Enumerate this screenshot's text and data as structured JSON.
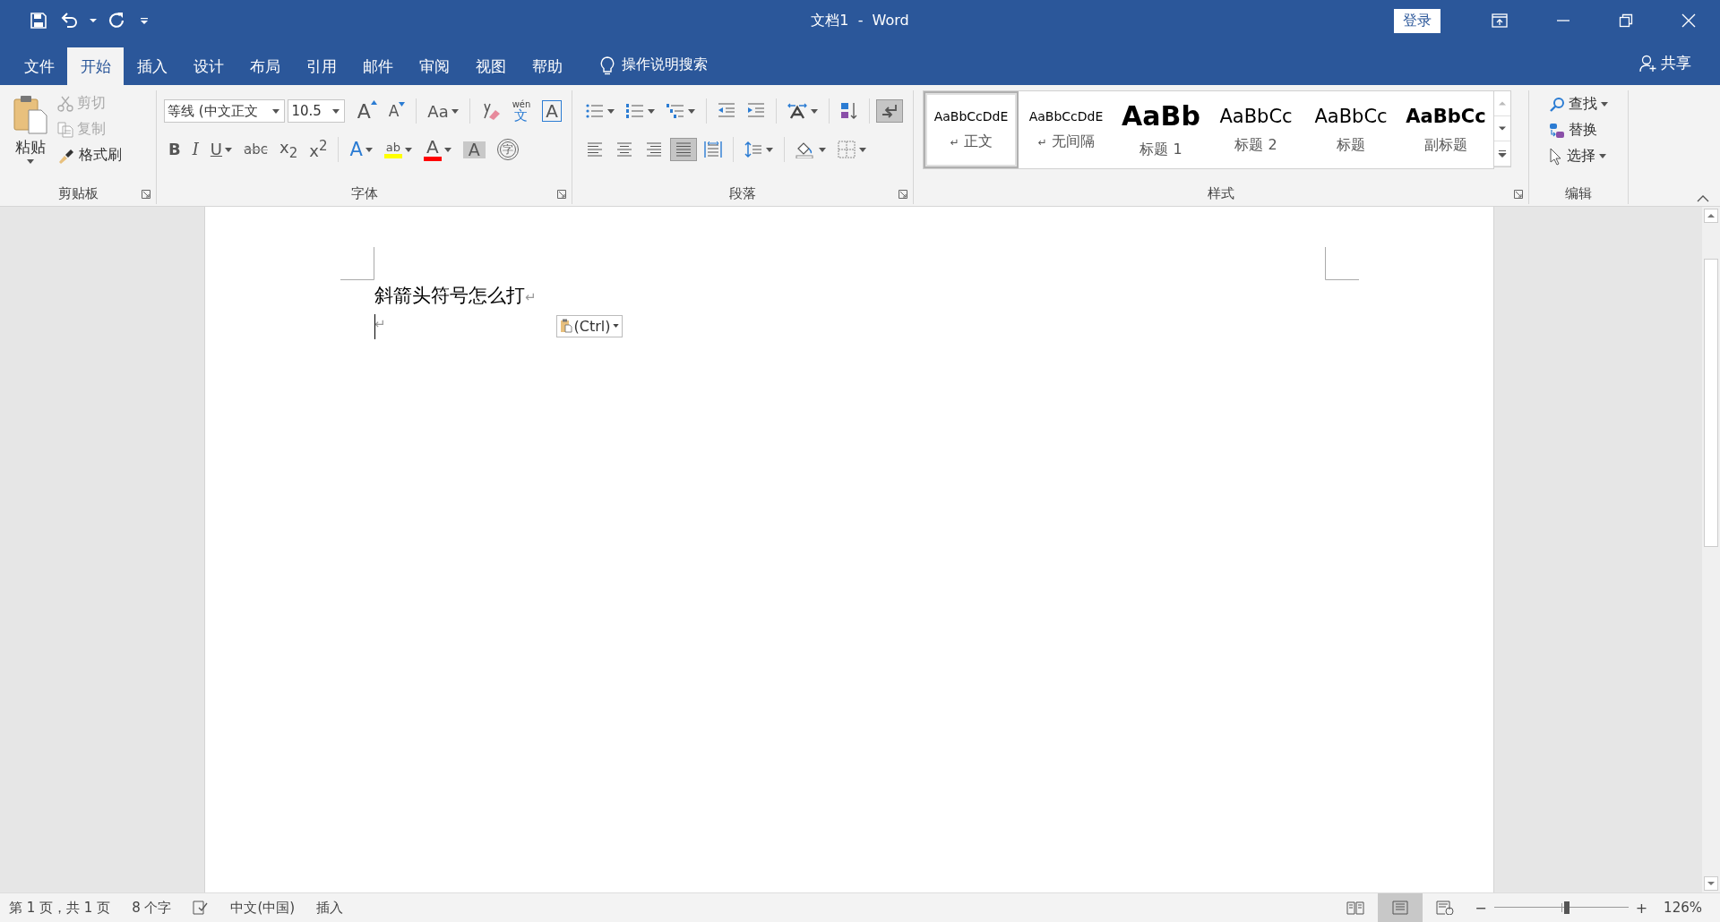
{
  "window": {
    "title": "文档1  -  Word",
    "sign_in": "登录"
  },
  "tabs": [
    {
      "label": "文件",
      "selected": false
    },
    {
      "label": "开始",
      "selected": true
    },
    {
      "label": "插入",
      "selected": false
    },
    {
      "label": "设计",
      "selected": false
    },
    {
      "label": "布局",
      "selected": false
    },
    {
      "label": "引用",
      "selected": false
    },
    {
      "label": "邮件",
      "selected": false
    },
    {
      "label": "审阅",
      "selected": false
    },
    {
      "label": "视图",
      "selected": false
    },
    {
      "label": "帮助",
      "selected": false
    }
  ],
  "tell_me": "操作说明搜索",
  "share": "共享",
  "clipboard": {
    "label": "剪贴板",
    "paste": "粘贴",
    "items": [
      {
        "kind": "cut",
        "label": "剪切",
        "disabled": true
      },
      {
        "kind": "copy",
        "label": "复制",
        "disabled": true
      },
      {
        "kind": "painter",
        "label": "格式刷",
        "disabled": false
      }
    ]
  },
  "font": {
    "label": "字体",
    "name": "等线 (中文正文",
    "size": "10.5",
    "row1": [
      {
        "kind": "grow",
        "text": "A"
      },
      {
        "kind": "shrink",
        "text": "A"
      },
      {
        "kind": "case",
        "text": "Aa",
        "caret": true
      },
      {
        "kind": "clear"
      },
      {
        "kind": "phonetic",
        "text": "wén",
        "sub": "文"
      },
      {
        "kind": "border",
        "text": "A"
      }
    ],
    "row2": [
      {
        "kind": "bold",
        "text": "B"
      },
      {
        "kind": "italic",
        "text": "I"
      },
      {
        "kind": "underline",
        "text": "U",
        "caret": true
      },
      {
        "kind": "strike",
        "text": "abc"
      },
      {
        "kind": "subscript",
        "text": "x$_{2}$"
      },
      {
        "kind": "superscript",
        "text": "x$^{2}$"
      },
      {
        "kind": "effects",
        "text": "A",
        "caret": true
      },
      {
        "kind": "highlight",
        "text": "ab",
        "color": "#ffff00",
        "caret": true
      },
      {
        "kind": "fontcolor",
        "text": "A",
        "color": "#ff0000",
        "caret": true
      },
      {
        "kind": "shade",
        "text": "A"
      },
      {
        "kind": "enclose",
        "text": "字"
      }
    ]
  },
  "paragraph": {
    "label": "段落",
    "row1": [
      {
        "kind": "bullets",
        "on": false,
        "caret": true
      },
      {
        "kind": "numbering",
        "on": false,
        "caret": true
      },
      {
        "kind": "multilevel",
        "on": false,
        "caret": true
      },
      {
        "kind": "outdent",
        "on": false
      },
      {
        "kind": "indent",
        "on": false
      },
      {
        "kind": "asian",
        "on": false,
        "caret": true
      },
      {
        "kind": "sort",
        "on": false
      },
      {
        "kind": "marks",
        "on": true
      }
    ],
    "row2": [
      {
        "kind": "left",
        "on": false
      },
      {
        "kind": "center",
        "on": false
      },
      {
        "kind": "right",
        "on": false
      },
      {
        "kind": "justify",
        "on": true
      },
      {
        "kind": "distribute",
        "on": false
      },
      {
        "kind": "spacing",
        "on": false,
        "caret": true
      },
      {
        "kind": "shading",
        "on": false,
        "caret": true
      },
      {
        "kind": "borders",
        "on": false,
        "caret": true
      }
    ]
  },
  "styles": {
    "label": "样式",
    "items": [
      {
        "kind": "normal",
        "preview": "AaBbCcDdE",
        "mark": "↵",
        "name": "正文",
        "selected": true
      },
      {
        "kind": "nospace",
        "preview": "AaBbCcDdE",
        "mark": "↵",
        "name": "无间隔",
        "selected": false
      },
      {
        "kind": "h1",
        "preview": "AaBb",
        "name": "标题 1",
        "selected": false
      },
      {
        "kind": "h2",
        "preview": "AaBbCc",
        "name": "标题 2",
        "selected": false
      },
      {
        "kind": "title",
        "preview": "AaBbCc",
        "name": "标题",
        "selected": false
      },
      {
        "kind": "subtitle",
        "preview": "AaBbCc",
        "name": "副标题",
        "selected": false
      }
    ]
  },
  "editing": {
    "label": "编辑",
    "items": [
      {
        "kind": "find",
        "label": "查找",
        "caret": true
      },
      {
        "kind": "replace",
        "label": "替换"
      },
      {
        "kind": "select",
        "label": "选择",
        "caret": true
      }
    ]
  },
  "document": {
    "paragraphs": [
      {
        "text": "斜箭头符号怎么打",
        "mark": "↵",
        "cursor": false
      },
      {
        "mark": "↵",
        "cursor": true
      }
    ],
    "paste_options": "(Ctrl)"
  },
  "status_bar": {
    "page": "第 1 页，共 1 页",
    "words": "8 个字",
    "language": "中文(中国)",
    "mode": "插入",
    "views": [
      {
        "kind": "read",
        "selected": false
      },
      {
        "kind": "print",
        "selected": true
      },
      {
        "kind": "web",
        "selected": false
      }
    ],
    "zoom": {
      "minus": "−",
      "plus": "+",
      "level": 0.54,
      "value": "126%"
    }
  }
}
